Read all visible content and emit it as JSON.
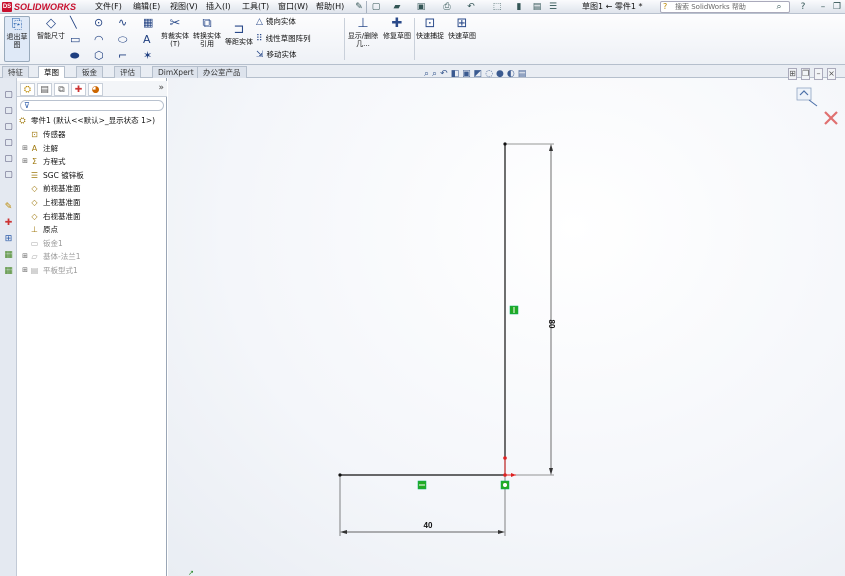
{
  "app": {
    "logo_text": "SOLIDWORKS",
    "document_title": "草图1 ← 零件1 *",
    "help_search_placeholder": "搜索 SolidWorks 帮助"
  },
  "menu": [
    {
      "label": "文件(F)"
    },
    {
      "label": "编辑(E)"
    },
    {
      "label": "视图(V)"
    },
    {
      "label": "插入(I)"
    },
    {
      "label": "工具(T)"
    },
    {
      "label": "窗口(W)"
    },
    {
      "label": "帮助(H)"
    }
  ],
  "ribbon": {
    "exit_sketch": "退出草图",
    "smart_dimension": "智能尺寸",
    "trim_entities": "剪裁实体(T)",
    "convert_entities": "转换实体引用",
    "offset_entities": "等距实体",
    "mirror_entities": "镜向实体",
    "linear_pattern": "线性草图阵列",
    "move_entities": "移动实体",
    "display_delete": "显示/删除几...",
    "repair_sketch": "修复草图",
    "quick_snaps": "快速捕捉",
    "rapid_sketch": "快速草图"
  },
  "tabs": [
    {
      "label": "特征",
      "active": false
    },
    {
      "label": "草图",
      "active": true
    },
    {
      "label": "钣金",
      "active": false
    },
    {
      "label": "评估",
      "active": false
    },
    {
      "label": "DimXpert",
      "active": false
    },
    {
      "label": "办公室产品",
      "active": false
    }
  ],
  "feature_tree": {
    "root": "零件1 (默认<<默认>_显示状态 1>)",
    "items": [
      {
        "label": "传感器",
        "expandable": false,
        "dim": false,
        "icon": "sensor-icon"
      },
      {
        "label": "注解",
        "expandable": true,
        "dim": false,
        "icon": "annotation-icon"
      },
      {
        "label": "方程式",
        "expandable": true,
        "dim": false,
        "icon": "equation-icon"
      },
      {
        "label": "SGC 镀锌板",
        "expandable": false,
        "dim": false,
        "icon": "material-icon"
      },
      {
        "label": "前视基准面",
        "expandable": false,
        "dim": false,
        "icon": "plane-icon"
      },
      {
        "label": "上视基准面",
        "expandable": false,
        "dim": false,
        "icon": "plane-icon"
      },
      {
        "label": "右视基准面",
        "expandable": false,
        "dim": false,
        "icon": "plane-icon"
      },
      {
        "label": "原点",
        "expandable": false,
        "dim": false,
        "icon": "origin-icon"
      },
      {
        "label": "钣金1",
        "expandable": false,
        "dim": true,
        "icon": "sheet-metal-icon"
      },
      {
        "label": "基体-法兰1",
        "expandable": true,
        "dim": true,
        "icon": "base-flange-icon"
      },
      {
        "label": "平板型式1",
        "expandable": true,
        "dim": true,
        "icon": "flat-pattern-icon"
      }
    ]
  },
  "sketch": {
    "dimension_horizontal": "40",
    "dimension_vertical": "80",
    "line_color": "#111111",
    "relation_color": "#22aa22",
    "origin_color": "#dd2222"
  },
  "colors": {
    "accent": "#1d5aa8",
    "brand": "#c8102e"
  }
}
